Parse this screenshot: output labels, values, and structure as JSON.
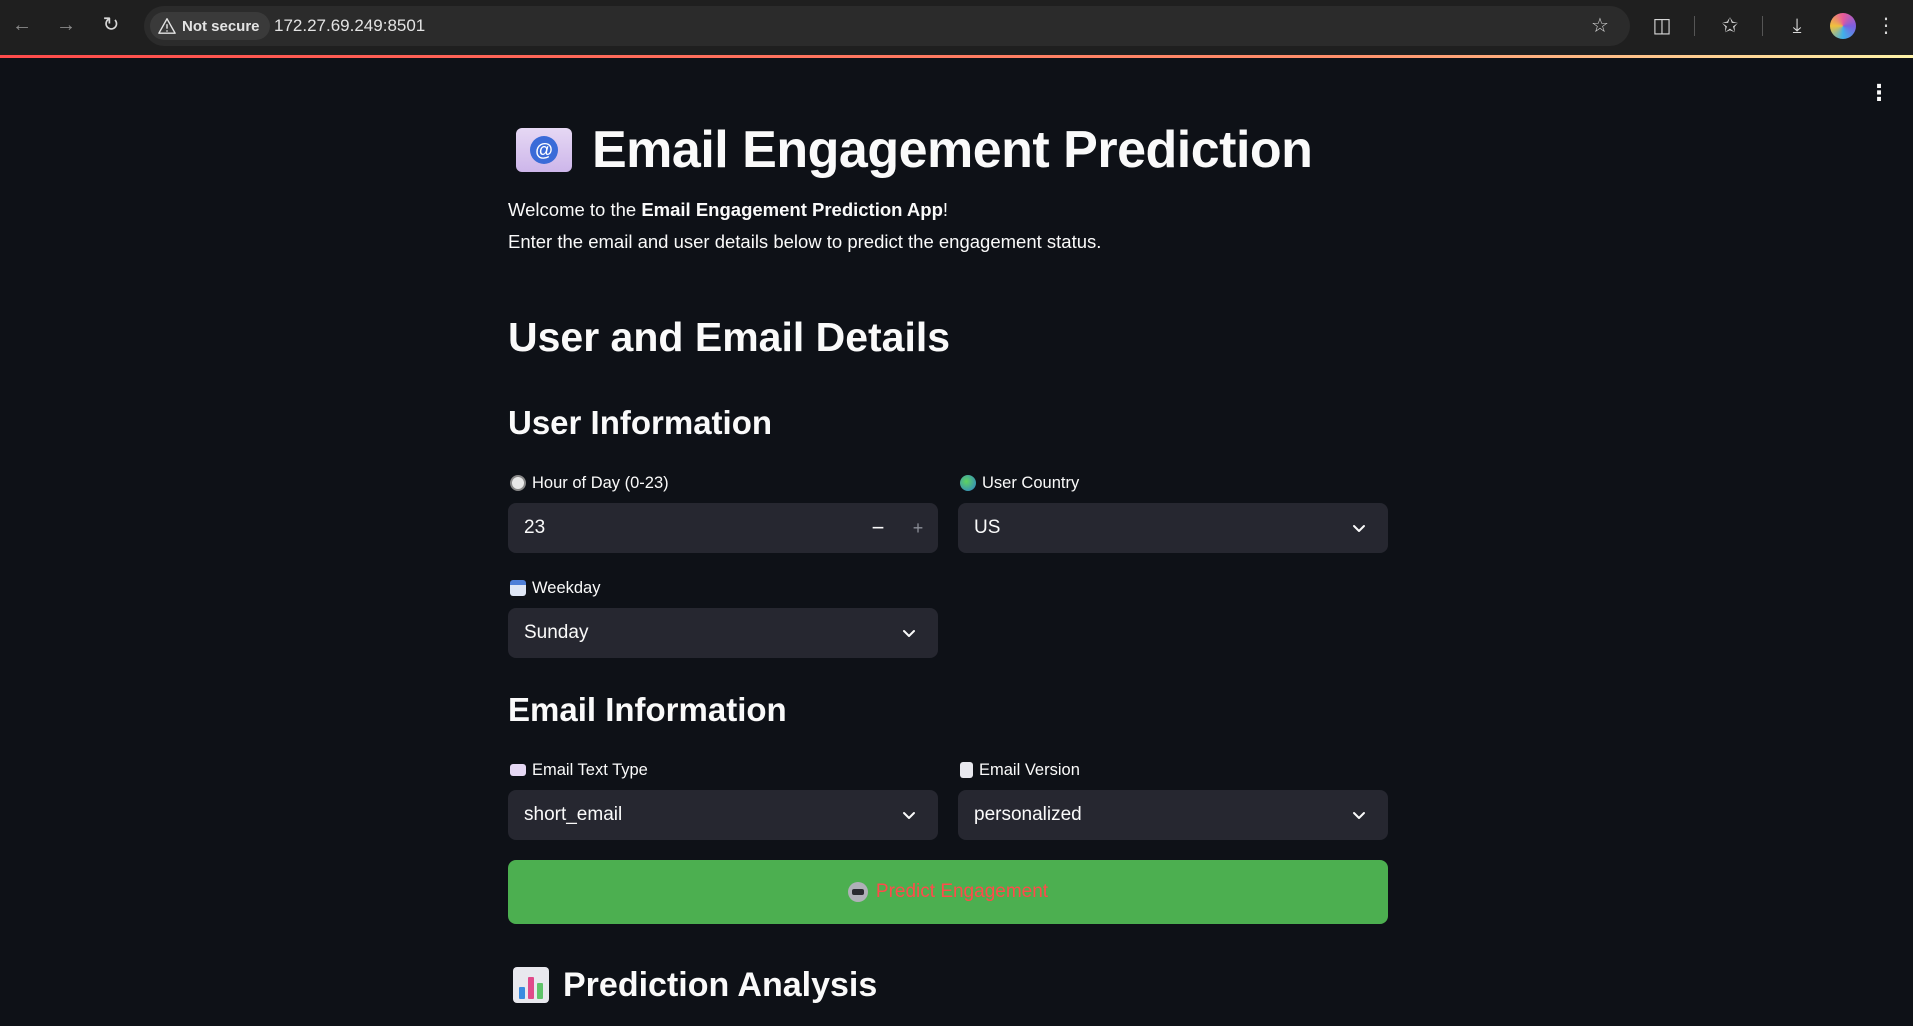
{
  "browser": {
    "security_label": "Not secure",
    "url": "172.27.69.249:8501"
  },
  "page": {
    "title": "Email Engagement Prediction",
    "title_emoji": "email-icon",
    "intro_prefix": "Welcome to the ",
    "intro_bold": "Email Engagement Prediction App",
    "intro_suffix": "!",
    "intro_line2": "Enter the email and user details below to predict the engagement status.",
    "section_heading": "User and Email Details",
    "user_info_heading": "User Information",
    "email_info_heading": "Email Information",
    "analysis_heading": "Prediction Analysis"
  },
  "form": {
    "hour": {
      "label": "Hour of Day (0-23)",
      "value": "23",
      "icon": "clock-icon"
    },
    "country": {
      "label": "User Country",
      "value": "US",
      "icon": "globe-icon"
    },
    "weekday": {
      "label": "Weekday",
      "value": "Sunday",
      "icon": "calendar-icon"
    },
    "email_text_type": {
      "label": "Email Text Type",
      "value": "short_email",
      "icon": "envelope-icon"
    },
    "email_version": {
      "label": "Email Version",
      "value": "personalized",
      "icon": "page-icon"
    }
  },
  "predict_button": {
    "label": "Predict Engagement",
    "icon": "robot-icon"
  },
  "colors": {
    "background": "#0e1117",
    "input_bg": "#262730",
    "button_bg": "#4caf50",
    "button_text": "#ff4b4b"
  }
}
